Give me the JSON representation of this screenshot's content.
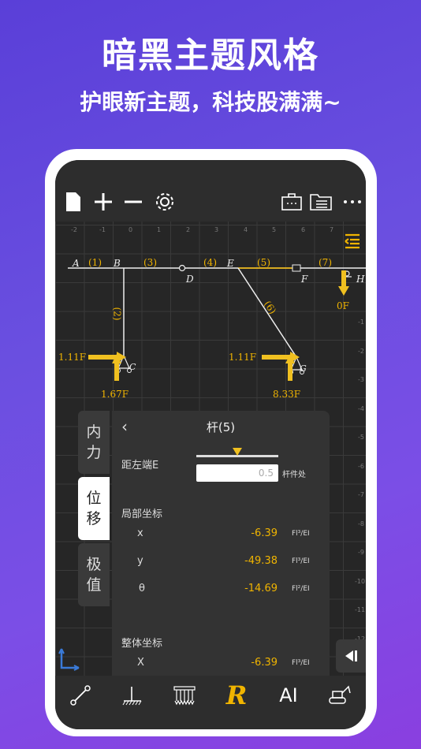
{
  "promo": {
    "headline": "暗黑主题风格",
    "subline": "护眼新主题，科技股满满~"
  },
  "toolbar": {
    "icons": [
      "file-icon",
      "plus-icon",
      "minus-icon",
      "gear-icon",
      "toolbox-icon",
      "folder-list-icon",
      "more-icon"
    ]
  },
  "ruler": {
    "top": [
      "-2",
      "-1",
      "0",
      "1",
      "2",
      "3",
      "4",
      "5",
      "6",
      "7"
    ],
    "right": [
      "-1",
      "-2",
      "-3",
      "-4",
      "-5",
      "-6",
      "-7",
      "-8",
      "-9",
      "-10",
      "-11",
      "-12"
    ]
  },
  "structure": {
    "nodes": [
      "A",
      "B",
      "D",
      "E",
      "F",
      "H",
      "C",
      "G"
    ],
    "members": [
      "(1)",
      "(3)",
      "(4)",
      "(5)",
      "(7)",
      "(2)",
      "(6)"
    ],
    "loads": [
      "1.11F",
      "1.67F",
      "1.11F",
      "8.33F",
      "0F"
    ]
  },
  "side_tabs": {
    "neili": "内\n力",
    "weiyi": "位\n移",
    "jizhi": "极\n值"
  },
  "panel": {
    "title": "杆(5)",
    "dist_label": "距左端E",
    "dist_value": "0.5",
    "dist_unit": "杆件处",
    "local_header": "局部坐标",
    "local": [
      {
        "axis": "x",
        "value": "-6.39",
        "unit": "Fl³/EI"
      },
      {
        "axis": "y",
        "value": "-49.38",
        "unit": "Fl³/EI"
      },
      {
        "axis": "θ",
        "value": "-14.69",
        "unit": "Fl²/EI"
      }
    ],
    "global_header": "整体坐标",
    "global": [
      {
        "axis": "X",
        "value": "-6.39",
        "unit": "Fl³/EI"
      }
    ]
  },
  "bottom": {
    "r_label": "R",
    "ai_label": "AI"
  },
  "colors": {
    "accent": "#f0b400",
    "bg_gradient_start": "#5a3fd8",
    "bg_gradient_end": "#8a3fe0"
  }
}
